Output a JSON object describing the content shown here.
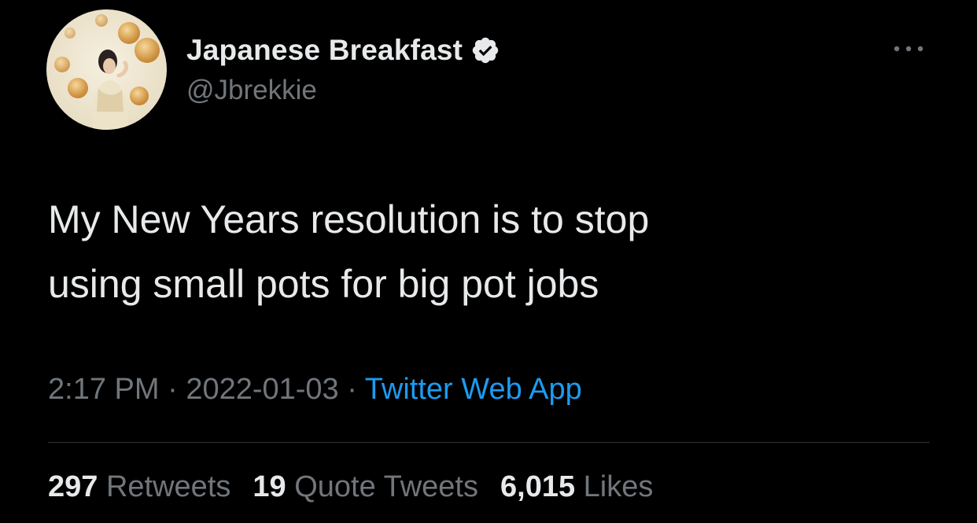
{
  "author": {
    "display_name": "Japanese Breakfast",
    "handle": "@Jbrekkie",
    "verified_icon": "verified-badge-icon",
    "avatar": "profile-photo"
  },
  "menu_icon": "more-horizontal-icon",
  "tweet": {
    "lines": [
      "My New Years resolution is to stop",
      "using small pots for big pot jobs"
    ]
  },
  "meta": {
    "time": "2:17 PM",
    "separator": " · ",
    "date": "2022-01-03",
    "source": "Twitter Web App"
  },
  "stats": {
    "retweets_count": "297",
    "retweets_label": "Retweets",
    "quotes_count": "19",
    "quotes_label": "Quote Tweets",
    "likes_count": "6,015",
    "likes_label": "Likes"
  },
  "colors": {
    "background": "#000000",
    "primary_text": "#e7e9ea",
    "secondary_text": "#71767b",
    "link": "#1d9bf0",
    "divider": "#2f3336"
  }
}
